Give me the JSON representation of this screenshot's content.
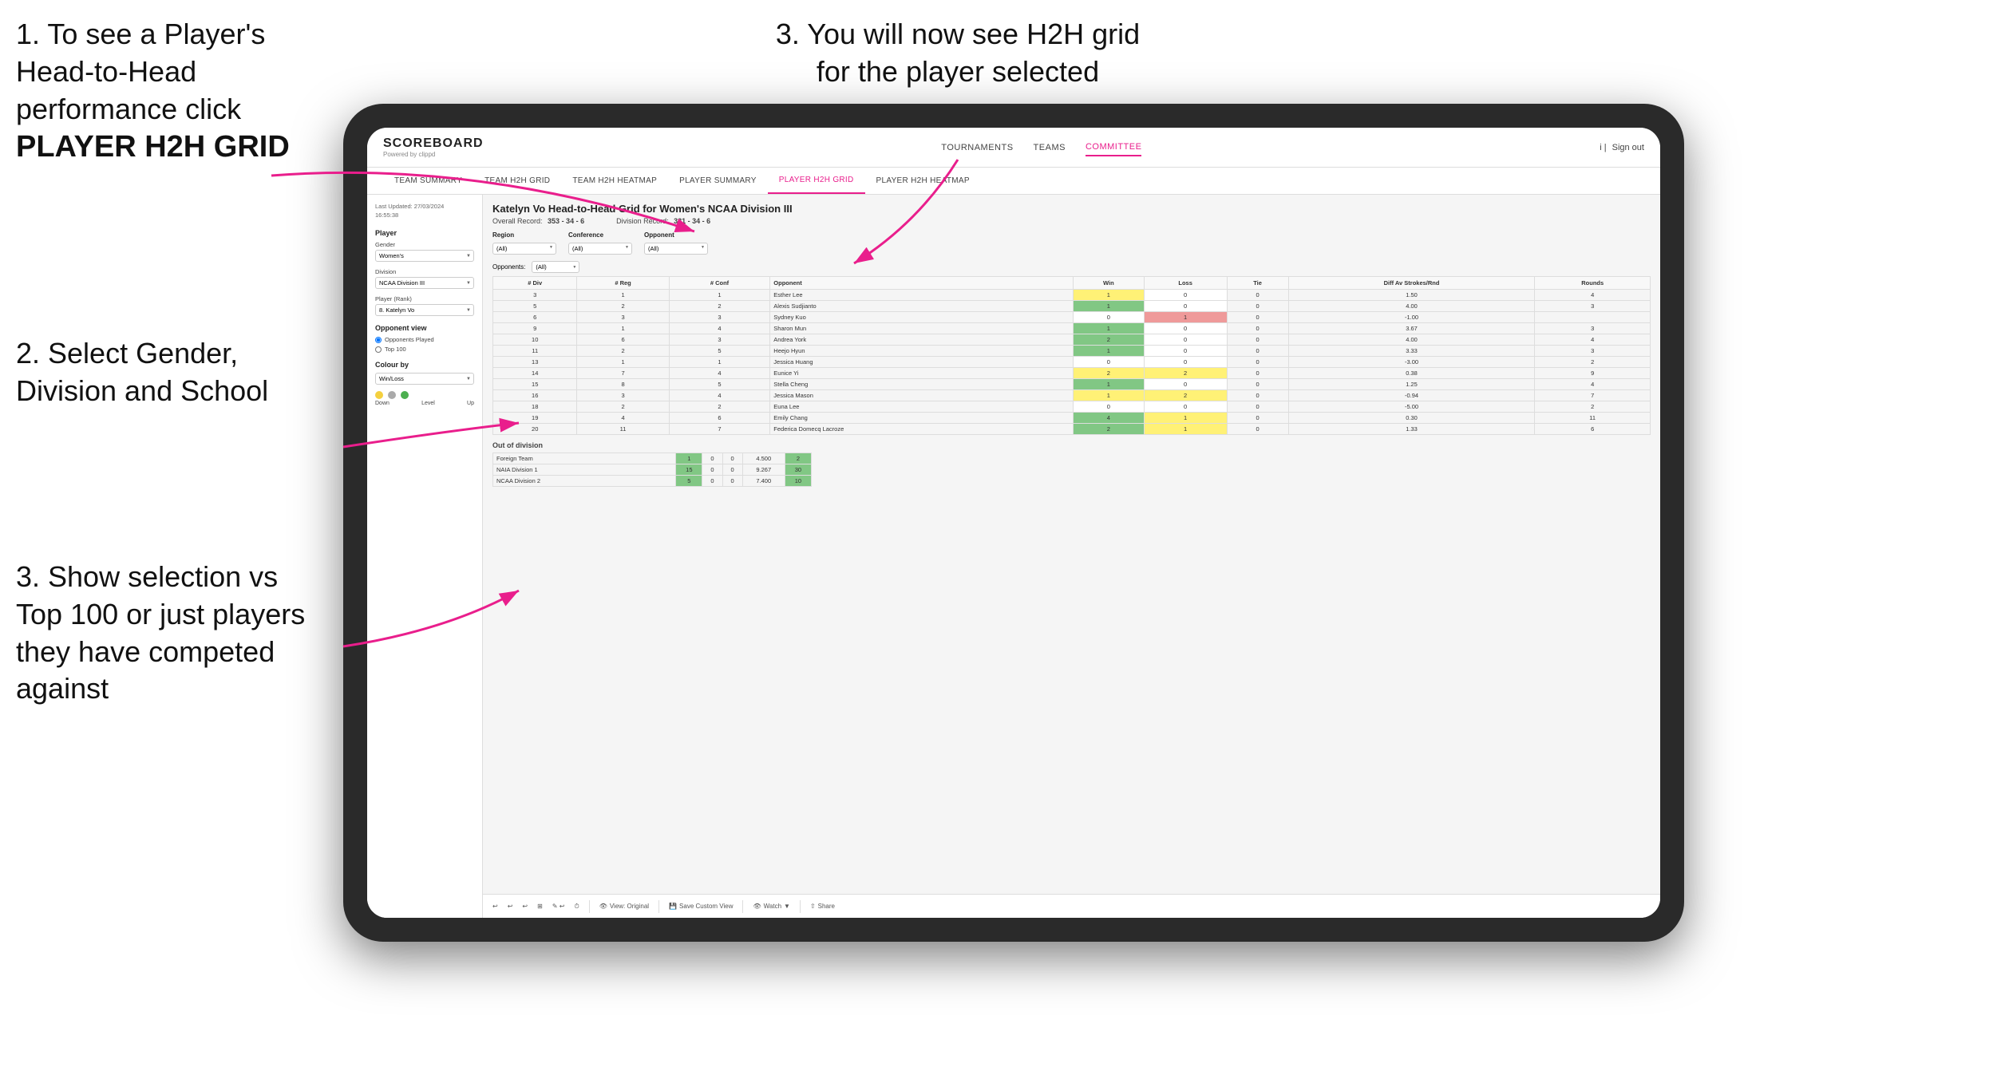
{
  "instructions": {
    "step1": {
      "text": "1. To see a Player's Head-to-Head performance click",
      "bold": "PLAYER H2H GRID"
    },
    "step2": {
      "text": "2. Select Gender, Division and School"
    },
    "step3_right": {
      "text": "3. You will now see H2H grid for the player selected"
    },
    "step3_bottom": {
      "text": "3. Show selection vs Top 100 or just players they have competed against"
    }
  },
  "app": {
    "logo": "SCOREBOARD",
    "logo_sub": "Powered by clippd",
    "nav_items": [
      "TOURNAMENTS",
      "TEAMS",
      "COMMITTEE"
    ],
    "active_nav": "COMMITTEE",
    "sign_out": "Sign out",
    "sub_nav_items": [
      "TEAM SUMMARY",
      "TEAM H2H GRID",
      "TEAM H2H HEATMAP",
      "PLAYER SUMMARY",
      "PLAYER H2H GRID",
      "PLAYER H2H HEATMAP"
    ],
    "active_sub_nav": "PLAYER H2H GRID"
  },
  "sidebar": {
    "timestamp_label": "Last Updated: 27/03/2024",
    "timestamp_time": "16:55:38",
    "player_section": "Player",
    "gender_label": "Gender",
    "gender_value": "Women's",
    "division_label": "Division",
    "division_value": "NCAA Division III",
    "player_rank_label": "Player (Rank)",
    "player_rank_value": "8. Katelyn Vo",
    "opponent_view_title": "Opponent view",
    "opponents_played_label": "Opponents Played",
    "top100_label": "Top 100",
    "colour_by_label": "Colour by",
    "colour_by_value": "Win/Loss",
    "colour_down": "Down",
    "colour_level": "Level",
    "colour_up": "Up"
  },
  "grid": {
    "title": "Katelyn Vo Head-to-Head Grid for Women's NCAA Division III",
    "overall_record_label": "Overall Record:",
    "overall_record_value": "353 - 34 - 6",
    "division_record_label": "Division Record:",
    "division_record_value": "331 - 34 - 6",
    "region_label": "Region",
    "conference_label": "Conference",
    "opponent_label": "Opponent",
    "opponents_label": "Opponents:",
    "all_value": "(All)",
    "columns": [
      "# Div",
      "# Reg",
      "# Conf",
      "Opponent",
      "Win",
      "Loss",
      "Tie",
      "Diff Av Strokes/Rnd",
      "Rounds"
    ],
    "rows": [
      {
        "div": 3,
        "reg": 1,
        "conf": 1,
        "opponent": "Esther Lee",
        "win": 1,
        "loss": 0,
        "tie": 0,
        "diff": "1.50",
        "rounds": 4,
        "win_color": "yellow",
        "loss_color": "",
        "tie_color": ""
      },
      {
        "div": 5,
        "reg": 2,
        "conf": 2,
        "opponent": "Alexis Sudjianto",
        "win": 1,
        "loss": 0,
        "tie": 0,
        "diff": "4.00",
        "rounds": 3,
        "win_color": "green",
        "loss_color": "",
        "tie_color": ""
      },
      {
        "div": 6,
        "reg": 3,
        "conf": 3,
        "opponent": "Sydney Kuo",
        "win": 0,
        "loss": 1,
        "tie": 0,
        "diff": "-1.00",
        "rounds": "",
        "win_color": "",
        "loss_color": "red",
        "tie_color": ""
      },
      {
        "div": 9,
        "reg": 1,
        "conf": 4,
        "opponent": "Sharon Mun",
        "win": 1,
        "loss": 0,
        "tie": 0,
        "diff": "3.67",
        "rounds": 3,
        "win_color": "green",
        "loss_color": "",
        "tie_color": ""
      },
      {
        "div": 10,
        "reg": 6,
        "conf": 3,
        "opponent": "Andrea York",
        "win": 2,
        "loss": 0,
        "tie": 0,
        "diff": "4.00",
        "rounds": 4,
        "win_color": "green",
        "loss_color": "",
        "tie_color": ""
      },
      {
        "div": 11,
        "reg": 2,
        "conf": 5,
        "opponent": "Heejo Hyun",
        "win": 1,
        "loss": 0,
        "tie": 0,
        "diff": "3.33",
        "rounds": 3,
        "win_color": "green",
        "loss_color": "",
        "tie_color": ""
      },
      {
        "div": 13,
        "reg": 1,
        "conf": 1,
        "opponent": "Jessica Huang",
        "win": 0,
        "loss": 0,
        "tie": 0,
        "diff": "-3.00",
        "rounds": 2,
        "win_color": "",
        "loss_color": "",
        "tie_color": ""
      },
      {
        "div": 14,
        "reg": 7,
        "conf": 4,
        "opponent": "Eunice Yi",
        "win": 2,
        "loss": 2,
        "tie": 0,
        "diff": "0.38",
        "rounds": 9,
        "win_color": "yellow",
        "loss_color": "yellow",
        "tie_color": ""
      },
      {
        "div": 15,
        "reg": 8,
        "conf": 5,
        "opponent": "Stella Cheng",
        "win": 1,
        "loss": 0,
        "tie": 0,
        "diff": "1.25",
        "rounds": 4,
        "win_color": "green",
        "loss_color": "",
        "tie_color": ""
      },
      {
        "div": 16,
        "reg": 3,
        "conf": 4,
        "opponent": "Jessica Mason",
        "win": 1,
        "loss": 2,
        "tie": 0,
        "diff": "-0.94",
        "rounds": 7,
        "win_color": "yellow",
        "loss_color": "yellow",
        "tie_color": ""
      },
      {
        "div": 18,
        "reg": 2,
        "conf": 2,
        "opponent": "Euna Lee",
        "win": 0,
        "loss": 0,
        "tie": 0,
        "diff": "-5.00",
        "rounds": 2,
        "win_color": "",
        "loss_color": "",
        "tie_color": ""
      },
      {
        "div": 19,
        "reg": 4,
        "conf": 6,
        "opponent": "Emily Chang",
        "win": 4,
        "loss": 1,
        "tie": 0,
        "diff": "0.30",
        "rounds": 11,
        "win_color": "green",
        "loss_color": "yellow",
        "tie_color": ""
      },
      {
        "div": 20,
        "reg": 11,
        "conf": 7,
        "opponent": "Federica Domecq Lacroze",
        "win": 2,
        "loss": 1,
        "tie": 0,
        "diff": "1.33",
        "rounds": 6,
        "win_color": "green",
        "loss_color": "yellow",
        "tie_color": ""
      }
    ],
    "out_of_division": "Out of division",
    "out_of_division_rows": [
      {
        "label": "Foreign Team",
        "win": 1,
        "loss": 0,
        "tie": 0,
        "diff": "4.500",
        "rounds": 2
      },
      {
        "label": "NAIA Division 1",
        "win": 15,
        "loss": 0,
        "tie": 0,
        "diff": "9.267",
        "rounds": 30
      },
      {
        "label": "NCAA Division 2",
        "win": 5,
        "loss": 0,
        "tie": 0,
        "diff": "7.400",
        "rounds": 10
      }
    ]
  },
  "toolbar": {
    "view_original": "View: Original",
    "save_custom": "Save Custom View",
    "watch": "Watch",
    "share": "Share"
  }
}
